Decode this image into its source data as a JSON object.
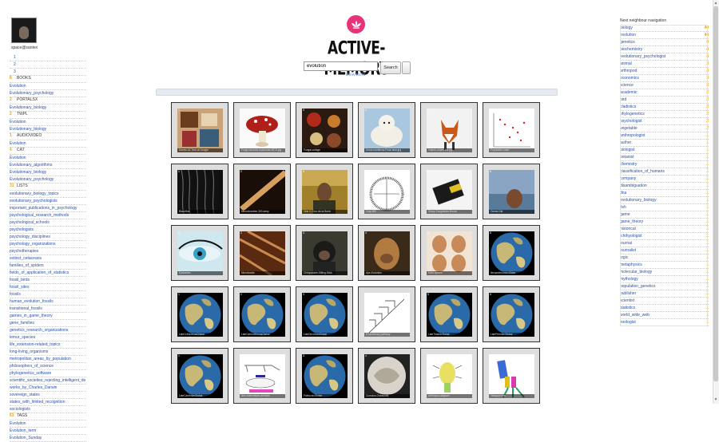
{
  "user": {
    "name": "space@santex"
  },
  "pages": [
    "1",
    "2",
    "3"
  ],
  "sections": [
    {
      "count": "8",
      "title": "BOOKS",
      "items": [
        "Evolution",
        "Evolutionary_psychology"
      ]
    },
    {
      "count": "2",
      "title": "PORTALSX",
      "items": [
        "Evolutionary_biology"
      ]
    },
    {
      "count": "2",
      "title": "TWPL",
      "items": [
        "Evolution",
        "Evolutionary_biology"
      ]
    },
    {
      "count": "1",
      "title": "AUDIOVIDEO",
      "items": [
        "Evolution"
      ]
    },
    {
      "count": "4",
      "title": "CAT",
      "items": [
        "Evolution",
        "Evolutionary_algorithms",
        "Evolutionary_biology",
        "Evolutionary_psychology"
      ]
    },
    {
      "count": "31",
      "title": "LISTS",
      "items": [
        "evolutionary_biology_topics",
        "evolutionary_psychologists",
        "important_publications_in_psychology",
        "psychological_research_methods",
        "psychological_schools",
        "psychologists",
        "psychology_disciplines",
        "psychology_organizations",
        "psychotherapies",
        "extinct_cetaceans",
        "families_of_spiders",
        "fields_of_application_of_statistics",
        "fossil_birds",
        "fossil_sites",
        "fossils",
        "human_evolution_fossils",
        "transitional_fossils",
        "games_in_game_theory",
        "gene_families",
        "genetics_research_organizations",
        "lemur_species",
        "life_extension-related_topics",
        "long-living_organisms",
        "metropolitan_areas_by_population",
        "philosophers_of_science",
        "phylogenetics_software",
        "scientific_societies_rejecting_intelligent_de",
        "works_by_Charles_Darwin",
        "sovereign_states",
        "states_with_limited_recognition",
        "sociologists"
      ]
    },
    {
      "count": "63",
      "title": "TAGS",
      "items": [
        "Evolution",
        "Evolution_term",
        "Evolution_Sunday"
      ]
    }
  ],
  "header": {
    "logo_text": "ACTIVE-MEMORY",
    "search_value": "evolution",
    "search_button": "Search",
    "show_tools": "show tool's"
  },
  "results": [
    {
      "num": "1",
      "caption": "Darwin-UI-Tree-of-Google",
      "theme": "collage"
    },
    {
      "num": "2",
      "caption": "Fungi-colourful-mushroom-BCD.jpg",
      "theme": "mushroom"
    },
    {
      "num": "3",
      "caption": "Fungal-collage",
      "theme": "fungi"
    },
    {
      "num": "4",
      "caption": "Ursus-maritimus-Polar-bear.jpg",
      "theme": "bear"
    },
    {
      "num": "5",
      "caption": "Vulpes-vulpes-fox.jpg",
      "theme": "fox"
    },
    {
      "num": "6",
      "caption": "Population-chart",
      "theme": "chart"
    },
    {
      "num": "1",
      "caption": "BlackHair",
      "theme": "hair"
    },
    {
      "num": "2",
      "caption": "Microchamber-300-lamp",
      "theme": "rod"
    },
    {
      "num": "3",
      "caption": "Vein-G-Tour-de-la-Burla",
      "theme": "person"
    },
    {
      "num": "4",
      "caption": "Cray-MB",
      "theme": "leaf"
    },
    {
      "num": "5",
      "caption": "Sharp-Sunglasses-Brown",
      "theme": "device"
    },
    {
      "num": "6",
      "caption": "Ocean-Sat",
      "theme": "sea"
    },
    {
      "num": "1",
      "caption": "Eyelashes",
      "theme": "eye"
    },
    {
      "num": "2",
      "caption": "Microfossils",
      "theme": "fossil"
    },
    {
      "num": "3",
      "caption": "Chimpanzee-Sitting-Stick",
      "theme": "chimp"
    },
    {
      "num": "4",
      "caption": "Ape-Evolution",
      "theme": "ape"
    },
    {
      "num": "5",
      "caption": "Mold-spores",
      "theme": "eggs"
    },
    {
      "num": "6",
      "caption": "Neoproterozoic-Globe",
      "theme": "globe"
    },
    {
      "num": "1",
      "caption": "LateCretaceousGlobal",
      "theme": "globe"
    },
    {
      "num": "2",
      "caption": "LateCarboniferousGlobal",
      "theme": "globe"
    },
    {
      "num": "3",
      "caption": "LateDevonianGlobal",
      "theme": "globe"
    },
    {
      "num": "4",
      "caption": "Evolutionary-pathway",
      "theme": "diagram"
    },
    {
      "num": "5",
      "caption": "LateTriassicGlobal",
      "theme": "globe"
    },
    {
      "num": "6",
      "caption": "LatePermianGlobal",
      "theme": "globe"
    },
    {
      "num": "1",
      "caption": "LateCambrianGlobal",
      "theme": "globe"
    },
    {
      "num": "2",
      "caption": "Non-mammalian-amniote",
      "theme": "skeleton"
    },
    {
      "num": "3",
      "caption": "PaleozoicGlobal",
      "theme": "globe"
    },
    {
      "num": "4",
      "caption": "Cumulus-Ostracods",
      "theme": "micro"
    },
    {
      "num": "5",
      "caption": "Arthropod-diagram",
      "theme": "anatomy"
    },
    {
      "num": "6",
      "caption": "Tetrapod-limb",
      "theme": "limb"
    }
  ],
  "neighbours": {
    "title": "Next neighbour navigation",
    "items": [
      {
        "label": "biology",
        "count": "44"
      },
      {
        "label": "evolution",
        "count": "44"
      },
      {
        "label": "genetics",
        "count": "9"
      },
      {
        "label": "biochemistry",
        "count": "4"
      },
      {
        "label": "evolutionary_psychologist",
        "count": "4"
      },
      {
        "label": "animal",
        "count": "3"
      },
      {
        "label": "arthropod",
        "count": "3"
      },
      {
        "label": "economics",
        "count": "3"
      },
      {
        "label": "science",
        "count": "3"
      },
      {
        "label": "academic",
        "count": "2"
      },
      {
        "label": "bird",
        "count": "2"
      },
      {
        "label": "cladistics",
        "count": "2"
      },
      {
        "label": "phylogenetics",
        "count": "2"
      },
      {
        "label": "psychologist",
        "count": "2"
      },
      {
        "label": "vegetable",
        "count": "2"
      },
      {
        "label": "anthropologist",
        "count": "1"
      },
      {
        "label": "author",
        "count": "1"
      },
      {
        "label": "biologist",
        "count": "1"
      },
      {
        "label": "botanist",
        "count": "1"
      },
      {
        "label": "chemistry",
        "count": "1"
      },
      {
        "label": "classification_of_humans",
        "count": "1"
      },
      {
        "label": "company",
        "count": "1"
      },
      {
        "label": "disambiguation",
        "count": "1"
      },
      {
        "label": "dna",
        "count": "1"
      },
      {
        "label": "evolutionary_biology",
        "count": "1"
      },
      {
        "label": "fish",
        "count": "1"
      },
      {
        "label": "game",
        "count": "1"
      },
      {
        "label": "game_theory",
        "count": "1"
      },
      {
        "label": "historical",
        "count": "1"
      },
      {
        "label": "ichthyologist",
        "count": "1"
      },
      {
        "label": "journal",
        "count": "1"
      },
      {
        "label": "journalist",
        "count": "1"
      },
      {
        "label": "logic",
        "count": "1"
      },
      {
        "label": "metaphysics",
        "count": "1"
      },
      {
        "label": "molecular_biology",
        "count": "1"
      },
      {
        "label": "mythology",
        "count": "1"
      },
      {
        "label": "population_genetics",
        "count": "1"
      },
      {
        "label": "publisher",
        "count": "1"
      },
      {
        "label": "scientist",
        "count": "1"
      },
      {
        "label": "statistics",
        "count": "1"
      },
      {
        "label": "world_wide_web",
        "count": "1"
      },
      {
        "label": "zoologist",
        "count": "1"
      }
    ]
  },
  "colors": {
    "accent": "#e6337a",
    "count": "#e8a400",
    "link": "#2a4fa8"
  }
}
